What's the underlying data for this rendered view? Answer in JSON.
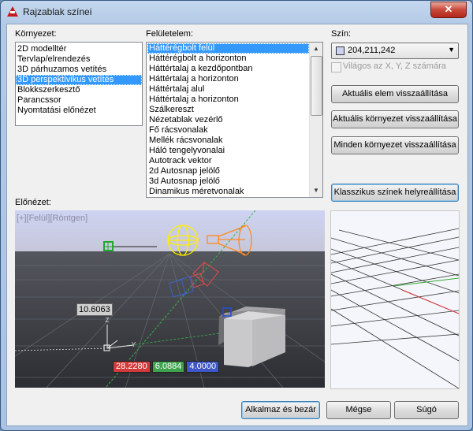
{
  "window": {
    "title": "Rajzablak színei",
    "close_glyph": "✕"
  },
  "environment": {
    "label": "Környezet:",
    "items": [
      "2D modelltér",
      "Tervlap/elrendezés",
      "3D párhuzamos vetítés",
      "3D perspektivikus vetítés",
      "Blokkszerkesztő",
      "Parancssor",
      "Nyomtatási előnézet"
    ],
    "selected_index": 3
  },
  "surface": {
    "label": "Felületelem:",
    "items": [
      "Háttérégbolt felül",
      "Háttérégbolt a horizonton",
      "Háttértalaj a kezdőpontban",
      "Háttértalaj a horizonton",
      "Háttértalaj alul",
      "Háttértalaj a horizonton",
      "Szálkereszt",
      "Nézetablak vezérlő",
      "Fő rácsvonalak",
      "Mellék rácsvonalak",
      "Háló tengelyvonalai",
      "Autotrack vektor",
      "2d Autosnap jelölő",
      "3d Autosnap jelölő",
      "Dinamikus méretvonalak"
    ],
    "selected_index": 0
  },
  "color": {
    "label": "Szín:",
    "value": "204,211,242",
    "swatch_color": "#ccd3f2",
    "tint_checkbox_label": "Világos az X, Y, Z számára",
    "tint_checked": false
  },
  "buttons": {
    "reset_element": "Aktuális elem visszaállítása",
    "reset_context": "Aktuális környezet visszaállítása",
    "reset_all": "Minden környezet visszaállítása",
    "restore_classic": "Klasszikus színek helyreállítása",
    "apply_close": "Alkalmaz és bezár",
    "cancel": "Mégse",
    "help": "Súgó"
  },
  "preview": {
    "label": "Előnézet:",
    "viewport_label": "[+][Felül][Röntgen]",
    "distance_value": "10.6063",
    "coords": [
      "28.2280",
      "6.0884",
      "4.0000"
    ],
    "coord_colors": [
      "#d03a3a",
      "#3fa34d",
      "#3f56c8"
    ]
  },
  "icons": {
    "app": "autocad-logo-icon",
    "close": "close-icon",
    "dropdown": "chevron-down-icon",
    "scroll_up": "scroll-up-icon",
    "scroll_down": "scroll-down-icon"
  }
}
